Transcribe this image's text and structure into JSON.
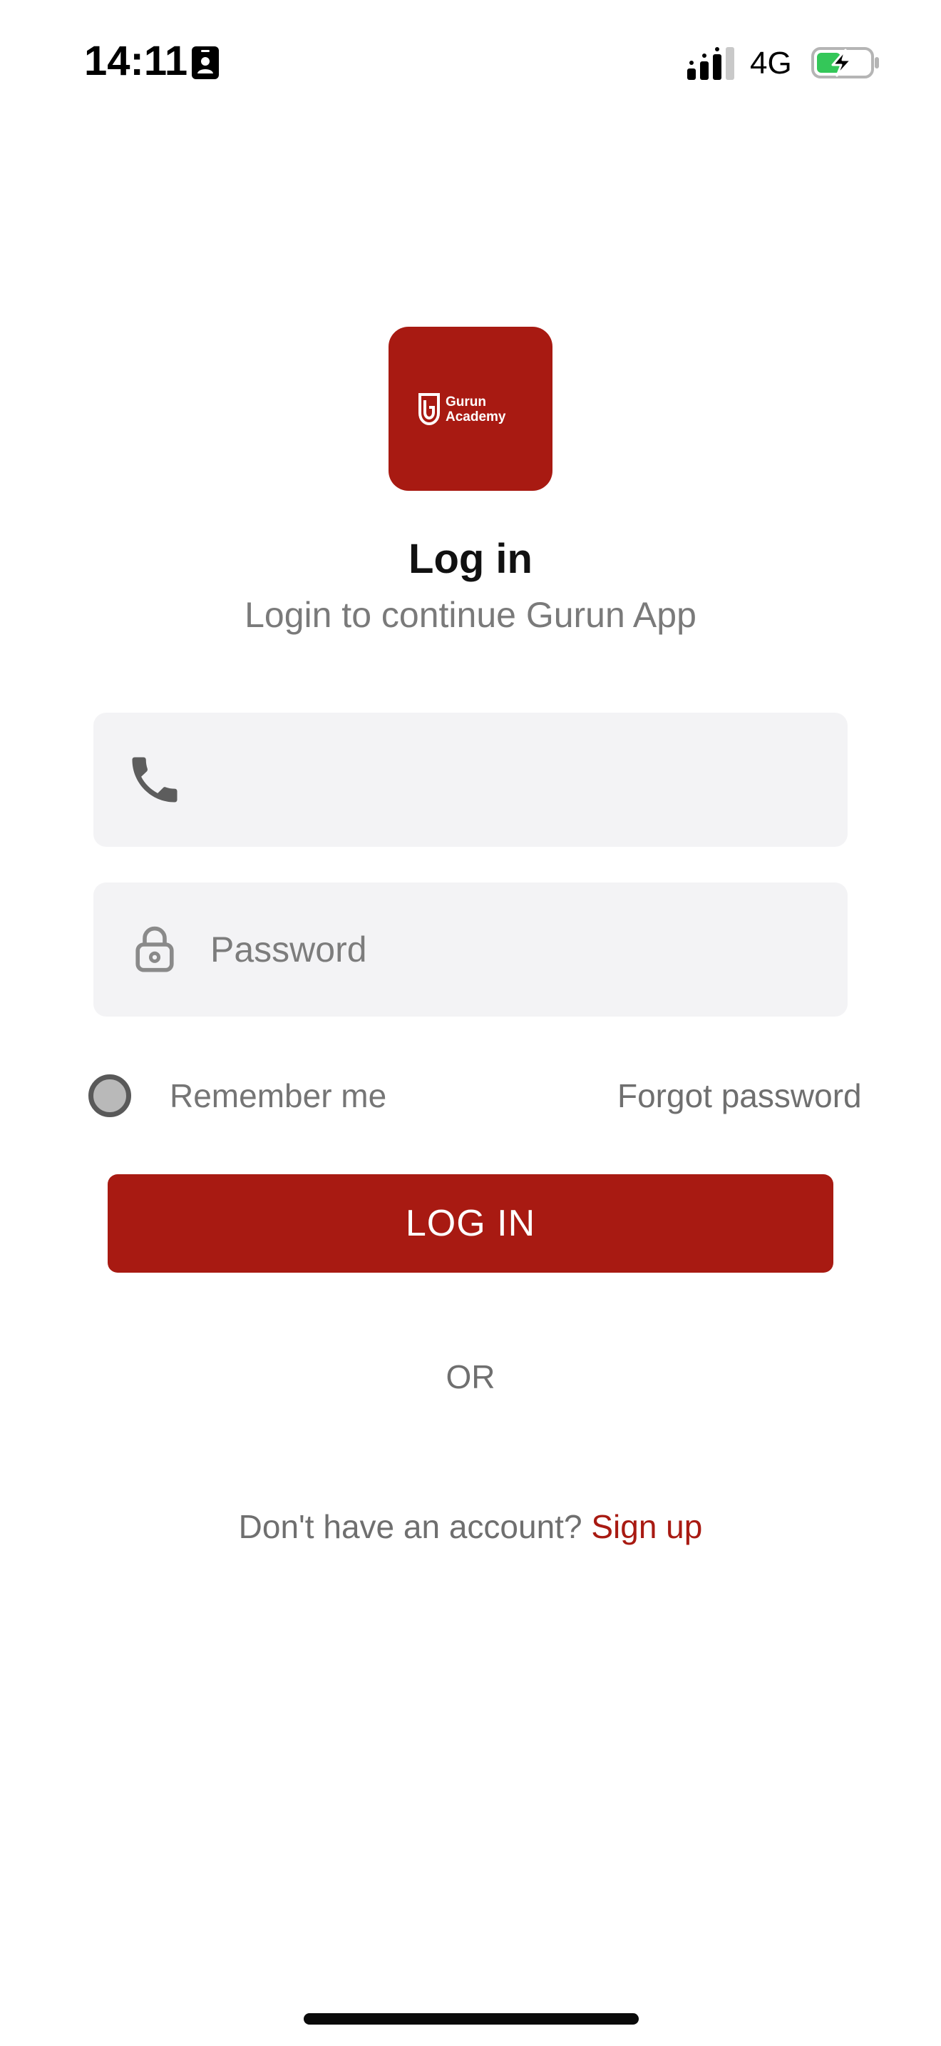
{
  "status_bar": {
    "time": "14:11",
    "network": "4G",
    "icons": [
      "id-card-icon",
      "signal-icon",
      "battery-charging-icon"
    ],
    "battery_level": 0.45
  },
  "logo": {
    "line1": "Gurun",
    "line2": "Academy",
    "background": "#a81a12"
  },
  "header": {
    "title": "Log in",
    "subtitle": "Login to continue Gurun App"
  },
  "form": {
    "phone": {
      "value": "",
      "placeholder": "",
      "icon": "phone-icon"
    },
    "password": {
      "value": "",
      "placeholder": "Password",
      "icon": "lock-icon"
    },
    "remember_label": "Remember me",
    "forgot_label": "Forgot password",
    "submit_label": "LOG IN"
  },
  "divider": {
    "or_label": "OR"
  },
  "signup": {
    "prompt": "Don't have an account?",
    "link_label": "Sign up"
  },
  "colors": {
    "accent": "#a81a12",
    "field_bg": "#f3f3f5",
    "muted_text": "#7a7a7a"
  }
}
